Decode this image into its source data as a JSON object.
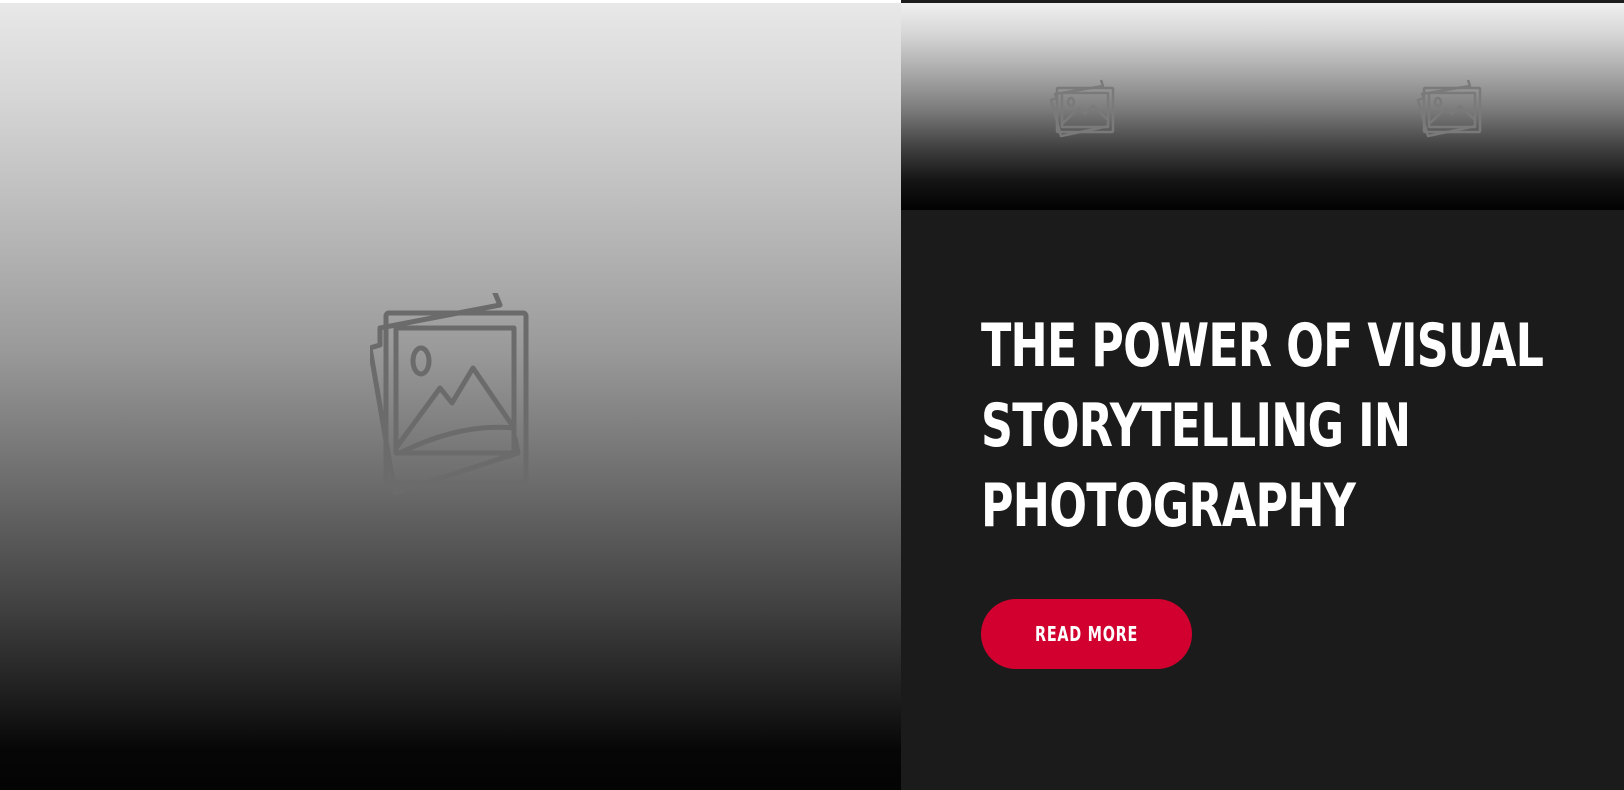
{
  "hero": {
    "left_image": {
      "icon": "image-placeholder-icon"
    },
    "thumbnails": [
      {
        "icon": "image-placeholder-icon"
      },
      {
        "icon": "image-placeholder-icon"
      }
    ]
  },
  "article": {
    "title": "THE POWER OF VISUAL\nSTORYTELLING IN\nPHOTOGRAPHY",
    "button_label": "READ MORE"
  },
  "colors": {
    "panel_background": "#1b1b1b",
    "button_background": "#d1002f",
    "title_text": "#ffffff"
  }
}
